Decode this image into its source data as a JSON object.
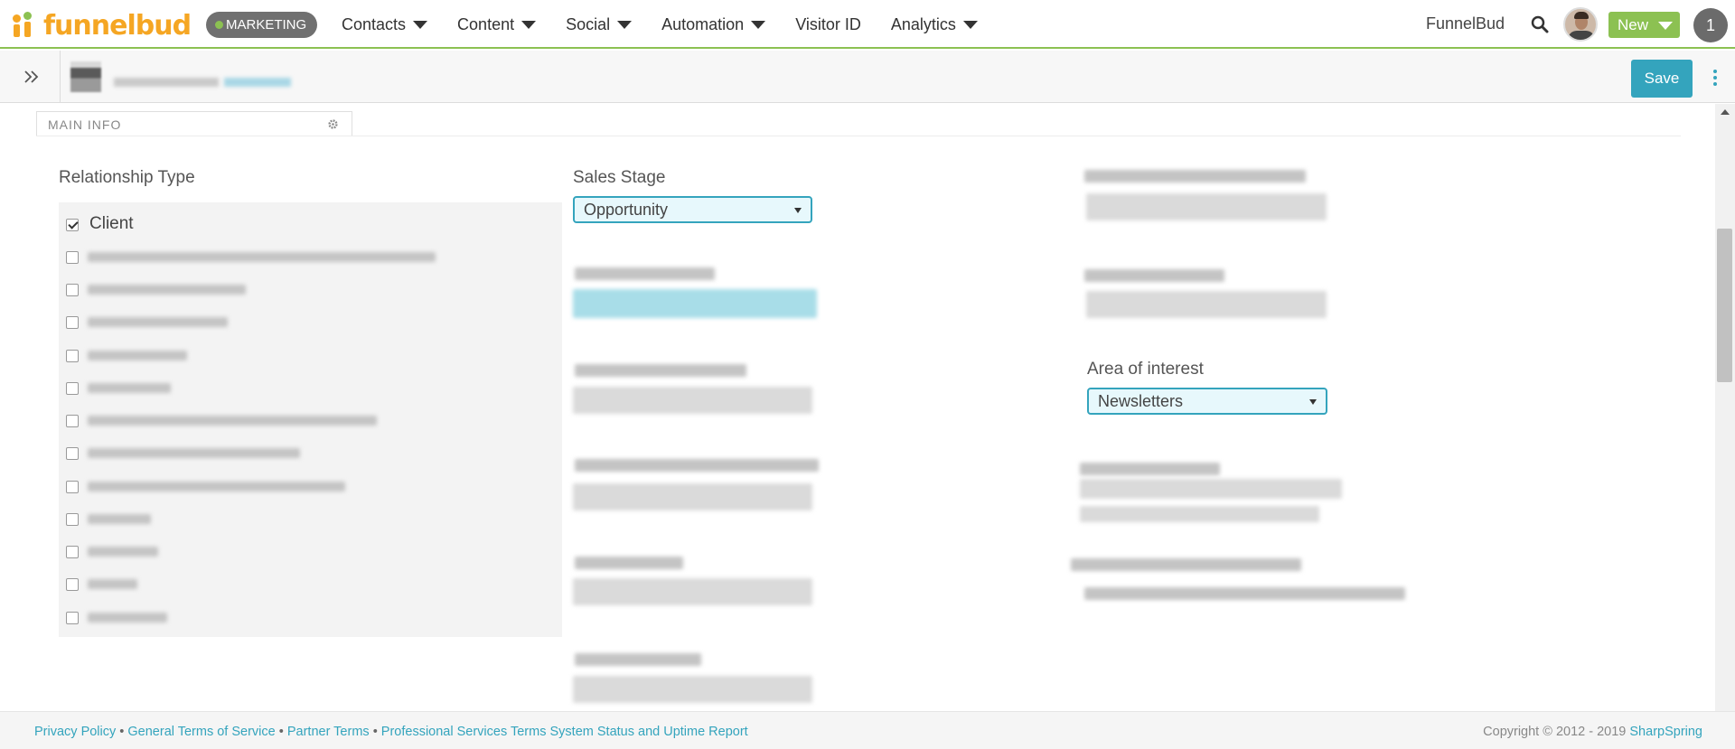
{
  "header": {
    "logo_text": "funnelbud",
    "workspace_badge": "MARKETING",
    "nav": [
      {
        "label": "Contacts",
        "has_dropdown": true
      },
      {
        "label": "Content",
        "has_dropdown": true
      },
      {
        "label": "Social",
        "has_dropdown": true
      },
      {
        "label": "Automation",
        "has_dropdown": true
      },
      {
        "label": "Visitor ID",
        "has_dropdown": false
      },
      {
        "label": "Analytics",
        "has_dropdown": true
      }
    ],
    "account_name": "FunnelBud",
    "new_button": "New",
    "notification_count": "1",
    "icons": {
      "search": "search-icon",
      "user": "avatar"
    }
  },
  "subbar": {
    "save_button": "Save",
    "icons": {
      "expand": "double-chevron-right-icon",
      "more": "kebab-menu-icon"
    }
  },
  "tab": {
    "label": "MAIN INFO",
    "icon": "gear-icon"
  },
  "form": {
    "relationship_type": {
      "label": "Relationship Type",
      "options": [
        {
          "label": "Client",
          "checked": true
        }
      ]
    },
    "sales_stage": {
      "label": "Sales Stage",
      "value": "Opportunity"
    },
    "area_of_interest": {
      "label": "Area of interest",
      "value": "Newsletters"
    }
  },
  "footer": {
    "links": [
      "Privacy Policy",
      "General Terms of Service",
      "Partner Terms",
      "Professional Services Terms",
      "System Status and Uptime Report"
    ],
    "separator": "•",
    "copyright": "Copyright © 2012 - 2019",
    "copyright_link": "SharpSpring"
  },
  "colors": {
    "brand_orange": "#f5a623",
    "brand_green": "#8cc152",
    "accent_teal": "#34a4bd",
    "select_bg": "#e7f8fc"
  }
}
